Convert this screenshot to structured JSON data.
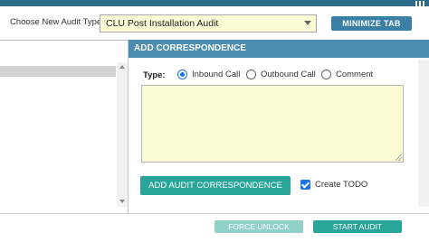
{
  "audit_type": {
    "label": "Choose New Audit Type:",
    "selected": "CLU Post Installation Audit"
  },
  "minimize_button": "MINIMIZE TAB",
  "correspondence": {
    "title": "ADD CORRESPONDENCE",
    "type_label": "Type:",
    "types": [
      {
        "label": "Inbound Call",
        "selected": true
      },
      {
        "label": "Outbound Call",
        "selected": false
      },
      {
        "label": "Comment",
        "selected": false
      }
    ],
    "text_value": "",
    "add_button": "ADD AUDIT CORRESPONDENCE",
    "create_todo_label": "Create TODO",
    "create_todo_checked": true
  },
  "footer": {
    "force_unlock": "FORCE UNLOCK",
    "start_audit": "START AUDIT"
  },
  "colors": {
    "header_bar": "#4a8db0",
    "primary_button": "#2aa59a",
    "disabled_button": "#8fd0c9",
    "input_background": "#fbfbd6"
  }
}
